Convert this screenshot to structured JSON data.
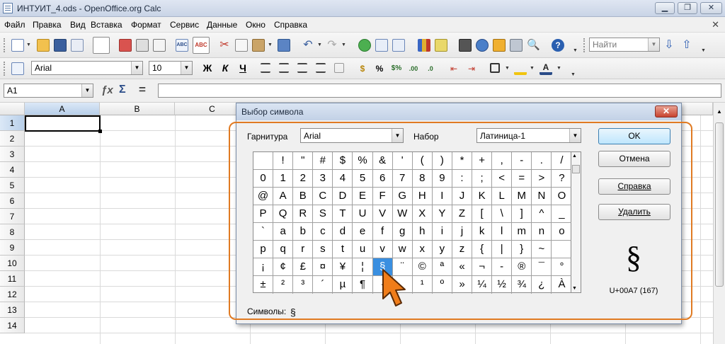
{
  "window": {
    "title": "ИНТУИТ_4.ods - OpenOffice.org Calc",
    "buttons": [
      "minimize-icon",
      "restore-icon",
      "close-icon"
    ]
  },
  "menu": [
    "Файл",
    "Правка",
    "Вид",
    "Вставка",
    "Формат",
    "Сервис",
    "Данные",
    "Окно",
    "Справка"
  ],
  "toolbar": {
    "find_placeholder": "Найти",
    "font_name": "Arial",
    "font_size": "10",
    "bold": "Ж",
    "italic": "К",
    "underline": "Ч"
  },
  "formula_bar": {
    "name_box": "A1",
    "sum_glyph": "Σ",
    "equals_glyph": "=",
    "content": ""
  },
  "sheet": {
    "columns": [
      "A",
      "B",
      "C"
    ],
    "rows": [
      "1",
      "2",
      "3",
      "4",
      "5",
      "6",
      "7",
      "8",
      "9",
      "10",
      "11",
      "12",
      "13",
      "14"
    ],
    "active_cell": "A1"
  },
  "dialog": {
    "title": "Выбор символа",
    "font_label": "Гарнитура",
    "font_value": "Arial",
    "subset_label": "Набор",
    "subset_value": "Латиница-1",
    "symbols": [
      " ",
      "!",
      "\"",
      "#",
      "$",
      "%",
      "&",
      "'",
      "(",
      ")",
      "*",
      "+",
      ",",
      "-",
      ".",
      "/",
      "0",
      "1",
      "2",
      "3",
      "4",
      "5",
      "6",
      "7",
      "8",
      "9",
      ":",
      ";",
      "<",
      "=",
      ">",
      "?",
      "@",
      "A",
      "B",
      "C",
      "D",
      "E",
      "F",
      "G",
      "H",
      "I",
      "J",
      "K",
      "L",
      "M",
      "N",
      "O",
      "P",
      "Q",
      "R",
      "S",
      "T",
      "U",
      "V",
      "W",
      "X",
      "Y",
      "Z",
      "[",
      "\\",
      "]",
      "^",
      "_",
      "`",
      "a",
      "b",
      "c",
      "d",
      "e",
      "f",
      "g",
      "h",
      "i",
      "j",
      "k",
      "l",
      "m",
      "n",
      "o",
      "p",
      "q",
      "r",
      "s",
      "t",
      "u",
      "v",
      "w",
      "x",
      "y",
      "z",
      "{",
      "|",
      "}",
      "~",
      " ",
      "¡",
      "¢",
      "£",
      "¤",
      "¥",
      "¦",
      "§",
      "¨",
      "©",
      "ª",
      "«",
      "¬",
      "-",
      "®",
      "¯",
      "°",
      "±",
      "²",
      "³",
      "´",
      "µ",
      "¶",
      "·",
      "¸",
      "¹",
      "º",
      "»",
      "¼",
      "½",
      "¾",
      "¿",
      "À"
    ],
    "selected_symbol": "§",
    "selected_index": 102,
    "buttons": {
      "ok": "OK",
      "cancel": "Отмена",
      "help": "Справка",
      "delete": "Удалить"
    },
    "preview_symbol": "§",
    "codepoint": "U+00A7 (167)",
    "symbols_label": "Символы:",
    "symbols_value": "§"
  },
  "colors": {
    "highlight_frame": "#e07a22",
    "selection": "#3a8fe0",
    "cursor": "#f07d1a"
  }
}
